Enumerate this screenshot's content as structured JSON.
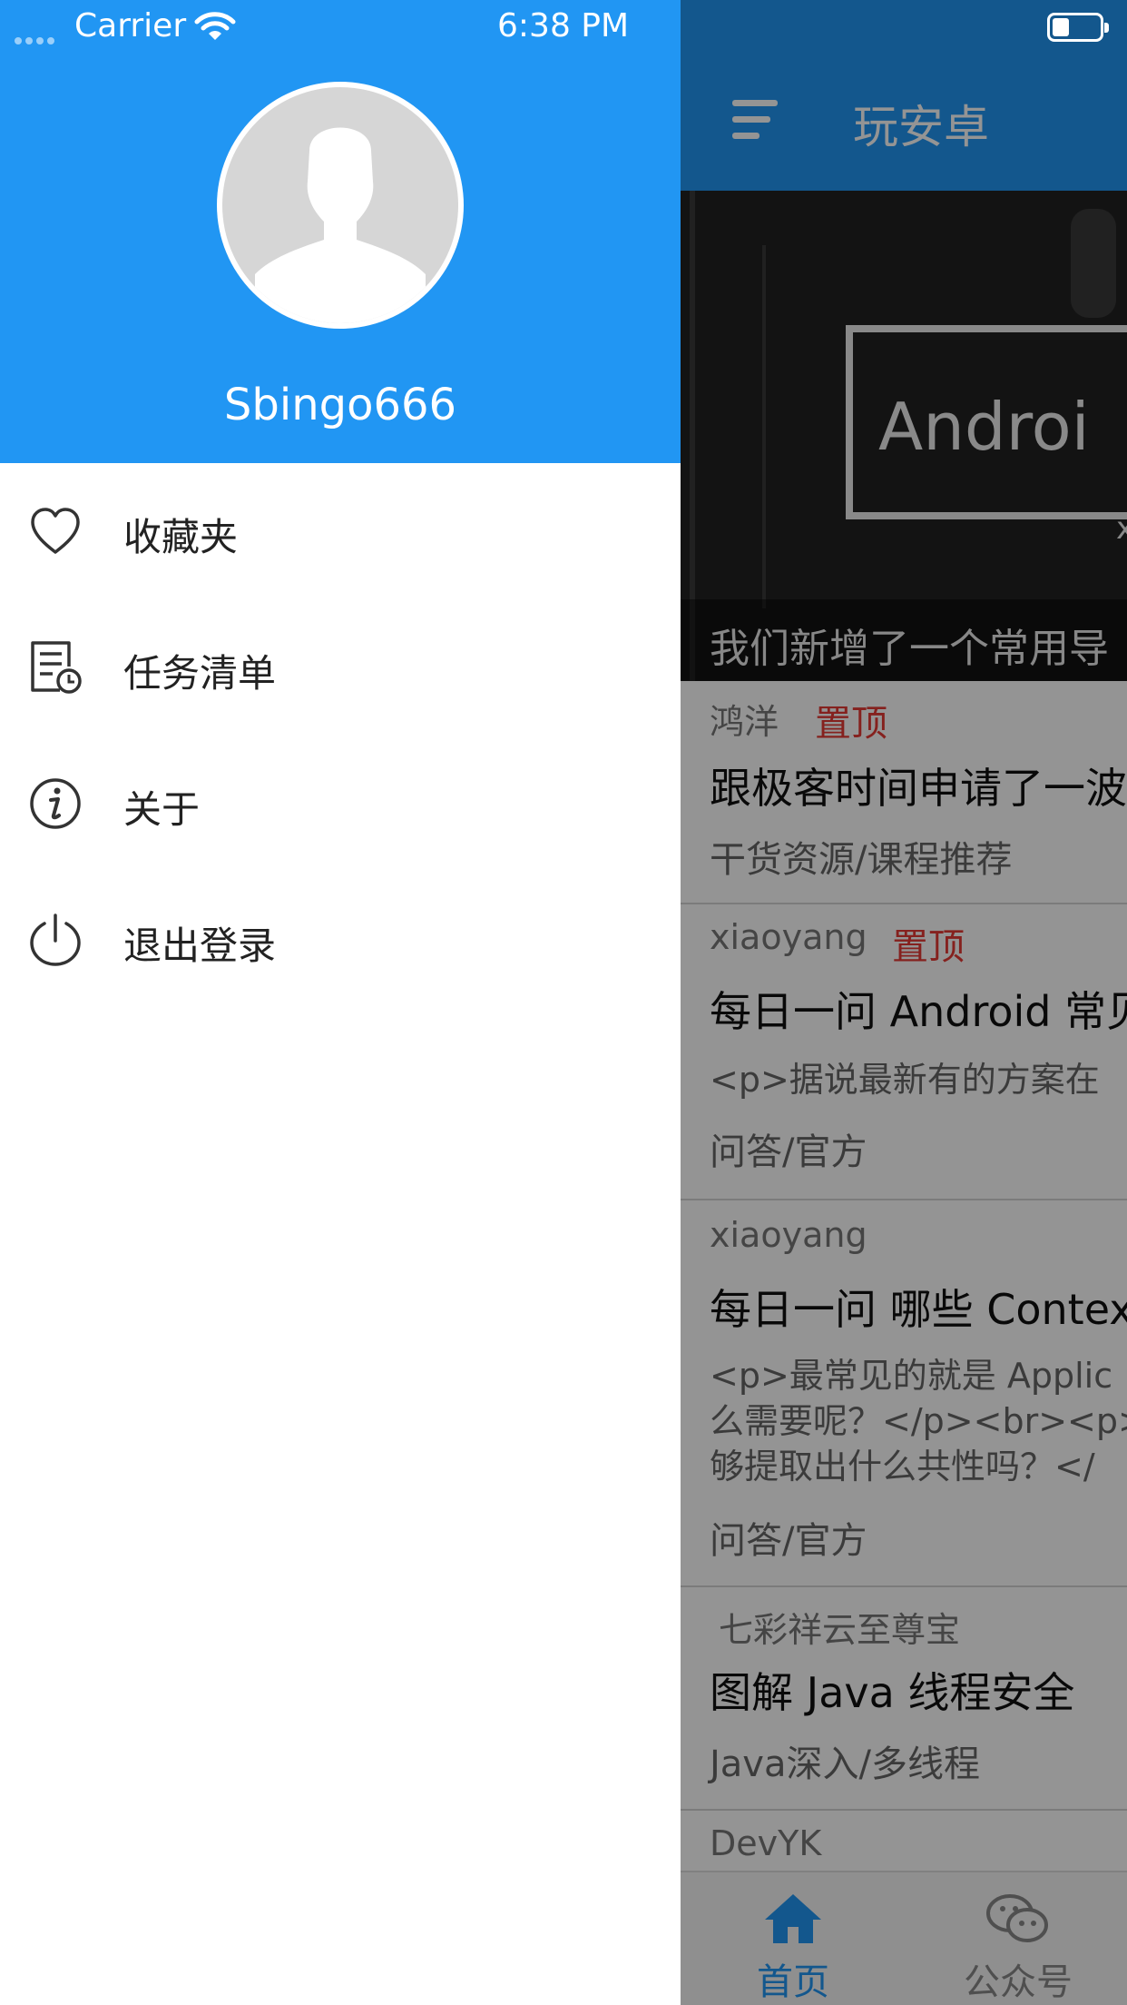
{
  "status_bar": {
    "carrier": "Carrier",
    "time": "6:38 PM"
  },
  "drawer": {
    "username": "Sbingo666",
    "menu": [
      {
        "label": "收藏夹",
        "icon": "heart-icon"
      },
      {
        "label": "任务清单",
        "icon": "task-list-icon"
      },
      {
        "label": "关于",
        "icon": "info-icon"
      },
      {
        "label": "退出登录",
        "icon": "power-icon"
      }
    ]
  },
  "main": {
    "title": "玩安卓",
    "banner": {
      "text": "Androi",
      "sub": "x",
      "caption": "我们新增了一个常用导"
    },
    "articles": [
      {
        "author": "鸿洋",
        "top": "置顶",
        "title": "跟极客时间申请了一波",
        "category": "干货资源/课程推荐"
      },
      {
        "author": "xiaoyang",
        "top": "置顶",
        "title": "每日一问 Android 常见",
        "desc": [
          "<p>据说最新有的方案在"
        ],
        "category": "问答/官方"
      },
      {
        "author": "xiaoyang",
        "title": "每日一问 哪些 Context",
        "desc": [
          "<p>最常见的就是 Applic",
          "么需要呢？</p><br><p>",
          "够提取出什么共性吗？</"
        ],
        "category": "问答/官方"
      },
      {
        "author": "七彩祥云至尊宝",
        "title": "图解 Java 线程安全",
        "category": "Java深入/多线程"
      },
      {
        "author": "DevYK"
      }
    ],
    "tabs": [
      {
        "label": "首页",
        "icon": "home-icon",
        "active": true
      },
      {
        "label": "公众号",
        "icon": "wechat-icon",
        "active": false
      }
    ]
  },
  "colors": {
    "primary": "#2196F3",
    "pinned": "#e53935"
  }
}
